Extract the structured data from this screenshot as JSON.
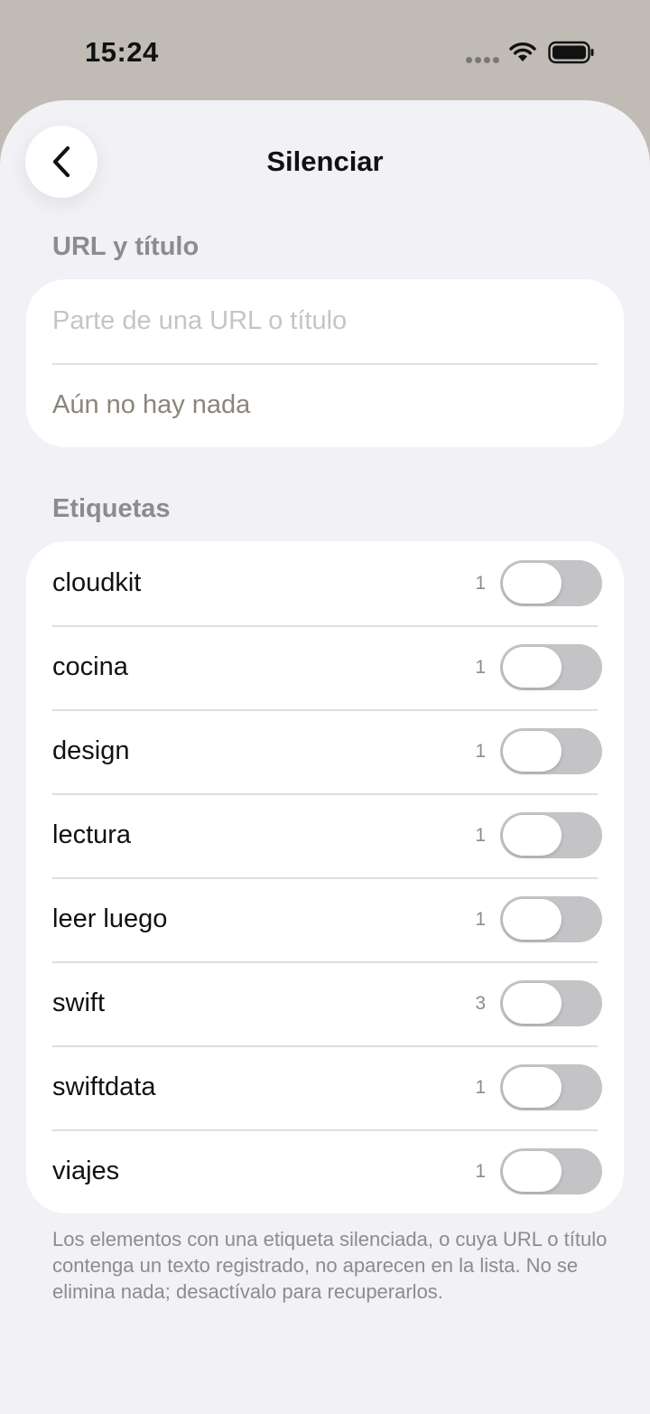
{
  "status_bar": {
    "time": "15:24",
    "icons": [
      "signal-dots-icon",
      "wifi-icon",
      "battery-icon"
    ]
  },
  "nav": {
    "back_icon": "chevron-left-icon",
    "title": "Silenciar"
  },
  "url_section": {
    "header": "URL y título",
    "input_placeholder": "Parte de una URL o título",
    "input_value": "",
    "empty_text": "Aún no hay nada"
  },
  "tags_section": {
    "header": "Etiquetas",
    "items": [
      {
        "label": "cloudkit",
        "count": "1",
        "on": false
      },
      {
        "label": "cocina",
        "count": "1",
        "on": false
      },
      {
        "label": "design",
        "count": "1",
        "on": false
      },
      {
        "label": "lectura",
        "count": "1",
        "on": false
      },
      {
        "label": "leer luego",
        "count": "1",
        "on": false
      },
      {
        "label": "swift",
        "count": "3",
        "on": false
      },
      {
        "label": "swiftdata",
        "count": "1",
        "on": false
      },
      {
        "label": "viajes",
        "count": "1",
        "on": false
      }
    ],
    "footer": "Los elementos con una etiqueta silenciada, o cuya URL o título contenga un texto registrado, no aparecen en la lista. No se elimina nada; desactívalo para recuperarlos."
  },
  "colors": {
    "background_top": "#c0bcb5",
    "sheet": "#f1f1f6",
    "card": "#ffffff",
    "toggle_off": "#c4c4c6",
    "secondary_text": "#8b8b91"
  }
}
